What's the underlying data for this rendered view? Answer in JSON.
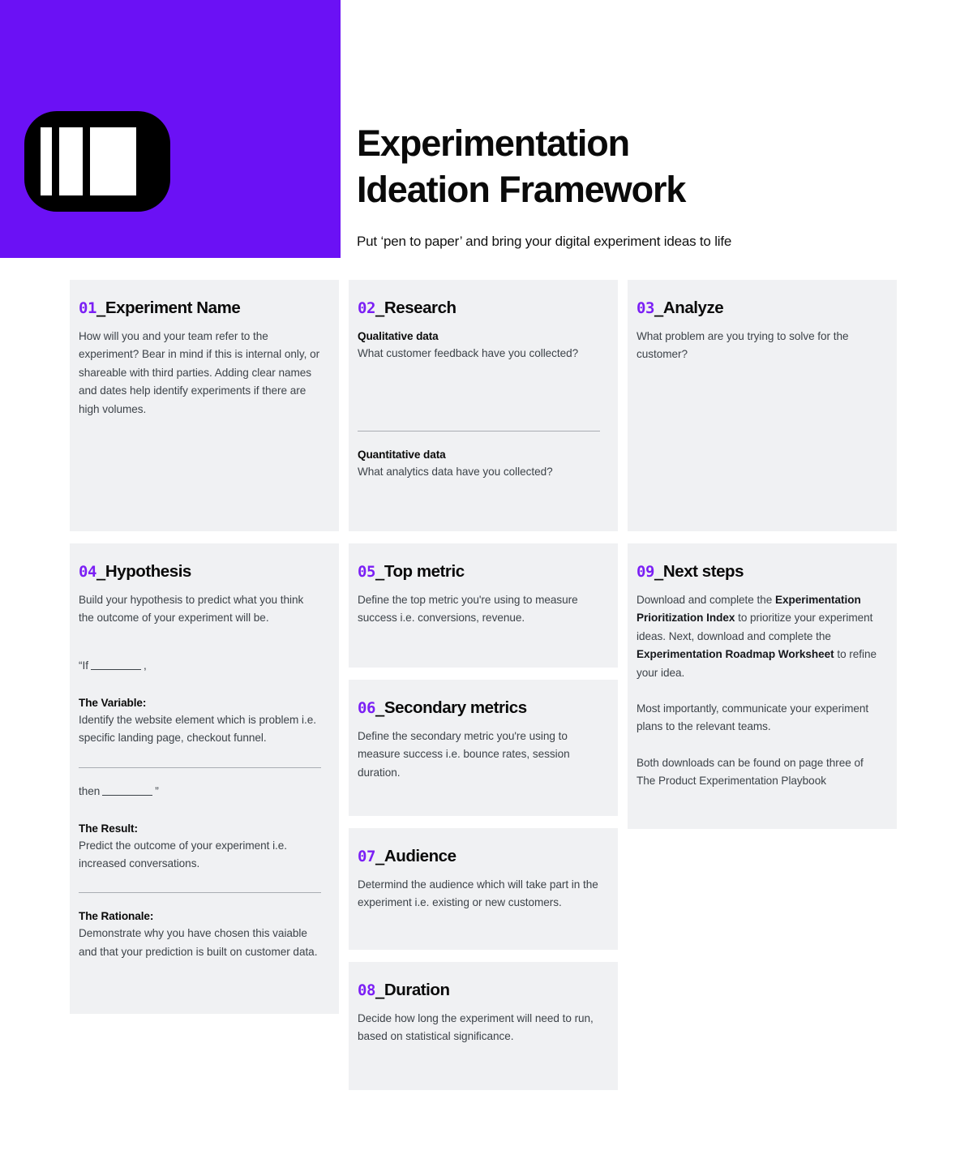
{
  "colors": {
    "brand_purple": "#6B11F5",
    "number_purple": "#7B1FF5",
    "card_bg": "#f0f1f3",
    "text": "#3d4349",
    "heading": "#0a0a0a"
  },
  "header": {
    "logo_name": "brand-logo-icon",
    "title_line1": "Experimentation",
    "title_line2": "Ideation Framework",
    "subtitle": "Put ‘pen to paper’ and bring your digital experiment ideas to life"
  },
  "cards": {
    "c1": {
      "number": "01",
      "separator": "_",
      "title": "Experiment Name",
      "body": "How will you and your team refer to the experiment? Bear in mind if this is internal only, or shareable with third parties. Adding clear names and dates help identify experiments if there are high volumes."
    },
    "c2": {
      "number": "02",
      "separator": "_",
      "title": "Research",
      "sub1_label": "Qualitative data",
      "sub1_body": "What customer feedback have you collected?",
      "sub2_label": "Quantitative data",
      "sub2_body": "What analytics data have you collected?"
    },
    "c3": {
      "number": "03",
      "separator": "_",
      "title": "Analyze",
      "body": "What problem are you trying to solve for the customer?"
    },
    "c4": {
      "number": "04",
      "separator": "_",
      "title": "Hypothesis",
      "body": "Build your hypothesis to predict what you think the outcome of your experiment will be.",
      "if_prefix": "“If",
      "if_suffix": ",",
      "variable_label": "The Variable:",
      "variable_body": "Identify the website element which is problem i.e. specific landing page, checkout funnel.",
      "then_prefix": "then",
      "then_suffix": "”",
      "result_label": "The Result:",
      "result_body": "Predict the outcome of your experiment i.e. increased conversations.",
      "rationale_label": "The Rationale:",
      "rationale_body": "Demonstrate why you have chosen this vaiable and that your prediction is built on customer data."
    },
    "c5": {
      "number": "05",
      "separator": "_",
      "title": "Top metric",
      "body": "Define the top metric you're using to measure success i.e. conversions, revenue."
    },
    "c6": {
      "number": "06",
      "separator": "_",
      "title": "Secondary metrics",
      "body": "Define the secondary metric you're using to measure success i.e. bounce rates, session duration."
    },
    "c7": {
      "number": "07",
      "separator": "_",
      "title": "Audience",
      "body": "Determind the audience which will take part in the experiment i.e. existing or new customers."
    },
    "c8": {
      "number": "08",
      "separator": "_",
      "title": "Duration",
      "body": "Decide how long the experiment will need to run, based on statistical significance."
    },
    "c9": {
      "number": "09",
      "separator": "_",
      "title": "Next steps",
      "p1_part1": "Download and complete the ",
      "p1_strong1": "Experimentation Prioritization Index",
      "p1_part2": " to prioritize your experiment ideas. Next, download and complete the ",
      "p1_strong2": "Experimentation Roadmap Worksheet",
      "p1_part3": " to refine your idea.",
      "p2": "Most importantly, communicate your experiment plans to the relevant teams.",
      "p3": "Both downloads can be found on page three of The Product Experimentation Playbook"
    }
  }
}
